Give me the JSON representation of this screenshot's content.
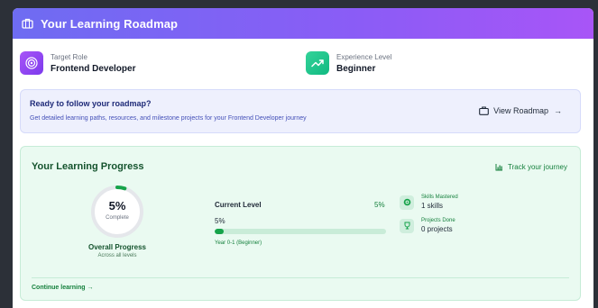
{
  "header": {
    "title": "Your Learning Roadmap",
    "icon": "map-icon"
  },
  "target": {
    "label": "Target Role",
    "value": "Frontend Developer",
    "icon": "target-icon"
  },
  "experience": {
    "label": "Experience Level",
    "value": "Beginner",
    "icon": "trending-up-icon"
  },
  "banner": {
    "title": "Ready to follow your roadmap?",
    "description": "Get detailed learning paths, resources, and milestone projects for your Frontend Developer journey",
    "button": "View Roadmap",
    "button_arrow": "→"
  },
  "progress": {
    "title": "Your Learning Progress",
    "track_link": "Track your journey",
    "overall": {
      "percent_text": "5%",
      "percent_value": 5,
      "complete_label": "Complete",
      "title": "Overall Progress",
      "subtitle": "Across all levels"
    },
    "current": {
      "label": "Current Level",
      "percent_right": "5%",
      "percent_text": "5%",
      "percent_value": 5,
      "year_label": "Year 0-1 (Beginner)"
    },
    "stats": [
      {
        "label": "Skills Mastered",
        "value": "1 skills",
        "icon": "target-icon"
      },
      {
        "label": "Projects Done",
        "value": "0 projects",
        "icon": "trophy-icon"
      }
    ],
    "continue": "Continue learning →"
  },
  "colors": {
    "accent": "#7c3aed",
    "green": "#16a34a",
    "header_start": "#6e6cf2",
    "header_end": "#a855f7"
  }
}
